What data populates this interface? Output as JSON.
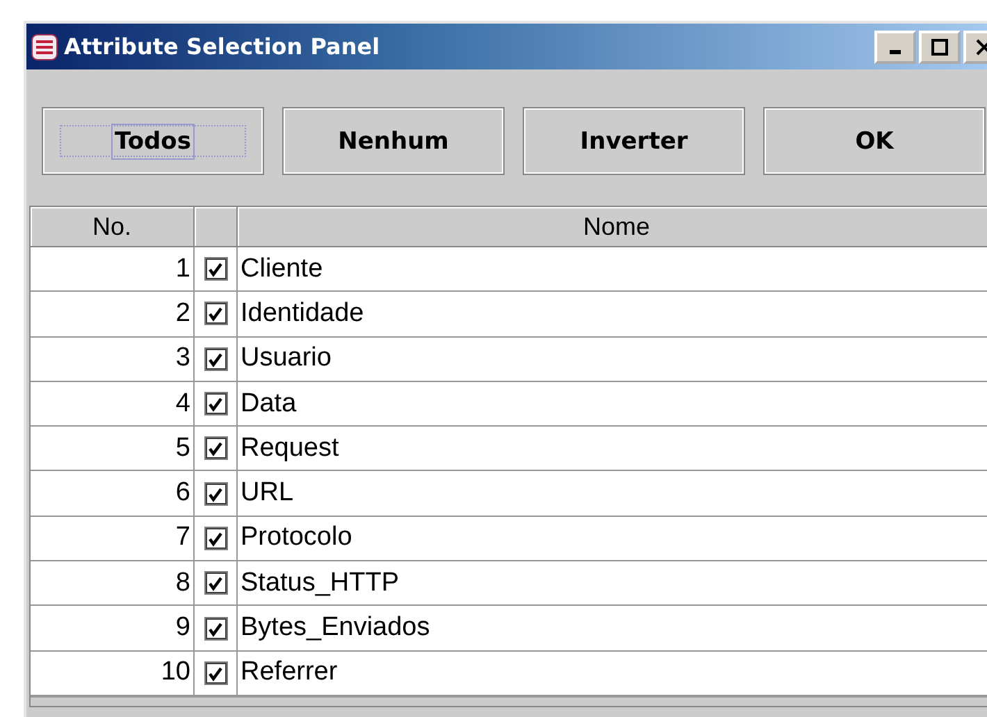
{
  "window": {
    "title": "Attribute Selection Panel"
  },
  "buttons": [
    {
      "label": "Todos",
      "focused": true
    },
    {
      "label": "Nenhum",
      "focused": false
    },
    {
      "label": "Inverter",
      "focused": false
    },
    {
      "label": "OK",
      "focused": false
    }
  ],
  "table": {
    "columns": [
      "No.",
      "Nome"
    ],
    "rows": [
      {
        "no": "1",
        "checked": true,
        "name": "Cliente"
      },
      {
        "no": "2",
        "checked": true,
        "name": "Identidade"
      },
      {
        "no": "3",
        "checked": true,
        "name": "Usuario"
      },
      {
        "no": "4",
        "checked": true,
        "name": "Data"
      },
      {
        "no": "5",
        "checked": true,
        "name": "Request"
      },
      {
        "no": "6",
        "checked": true,
        "name": "URL"
      },
      {
        "no": "7",
        "checked": true,
        "name": "Protocolo"
      },
      {
        "no": "8",
        "checked": true,
        "name": "Status_HTTP"
      },
      {
        "no": "9",
        "checked": true,
        "name": "Bytes_Enviados"
      },
      {
        "no": "10",
        "checked": true,
        "name": "Referrer"
      }
    ]
  }
}
